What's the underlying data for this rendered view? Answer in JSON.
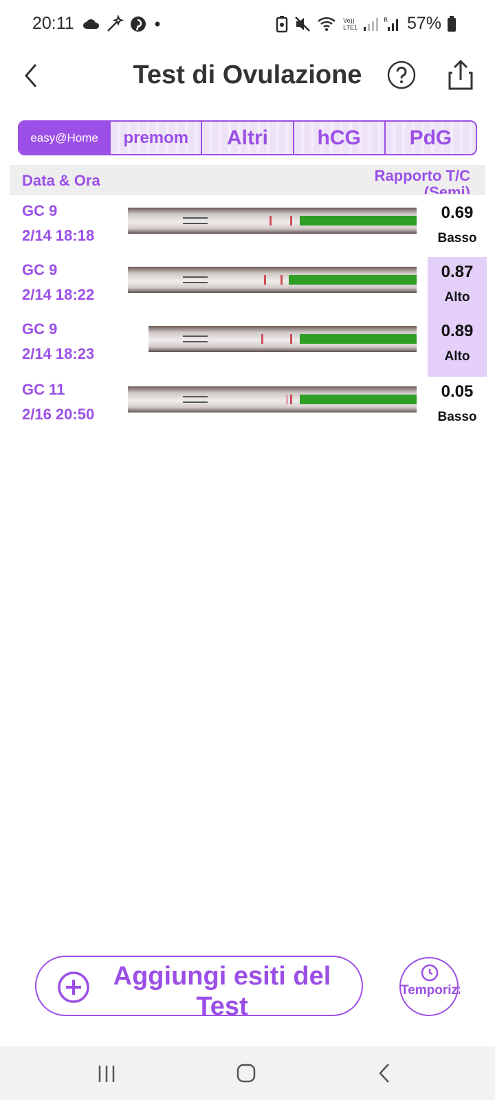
{
  "status_bar": {
    "time": "20:11",
    "battery_text": "57%",
    "left_icons": [
      "cloud-icon",
      "magic-wand-icon",
      "pinterest-icon",
      "dot-icon"
    ],
    "right_icons": [
      "battery-saver-icon",
      "mute-icon",
      "wifi-icon",
      "volte-icon",
      "signal-icon",
      "roaming-signal-icon",
      "battery-icon"
    ],
    "network_label": "LTE1",
    "volte_label": "Vo))"
  },
  "header": {
    "title": "Test di Ovulazione",
    "back_icon": "chevron-left-icon",
    "help_icon": "question-circle-icon",
    "share_icon": "share-icon"
  },
  "tabs": [
    {
      "label": "easy@Home",
      "active": true
    },
    {
      "label": "premom",
      "active": false
    },
    {
      "label": "Altri",
      "active": false
    },
    {
      "label": "hCG",
      "active": false
    },
    {
      "label": "PdG",
      "active": false
    }
  ],
  "table": {
    "col_date": "Data & Ora",
    "col_ratio": "Rapporto T/C (Semi)",
    "rows": [
      {
        "cycle_day": "GC 9",
        "date": "2/14  18:18",
        "value": "0.69",
        "level": "Basso",
        "high": false
      },
      {
        "cycle_day": "GC 9",
        "date": "2/14  18:22",
        "value": "0.87",
        "level": "Alto",
        "high": true
      },
      {
        "cycle_day": "GC 9",
        "date": "2/14  18:23",
        "value": "0.89",
        "level": "Alto",
        "high": true
      },
      {
        "cycle_day": "GC 11",
        "date": "2/16  20:50",
        "value": "0.05",
        "level": "Basso",
        "high": false
      }
    ]
  },
  "actions": {
    "add_results_label": "Aggiungi esiti del Test",
    "add_icon": "plus-circle-icon",
    "timer_label": "Temporizzatore",
    "timer_icon": "clock-icon"
  },
  "colors": {
    "accent": "#9b4fe6",
    "high_bg": "#e3cff8",
    "strip_green": "#2f9e25",
    "strip_line": "#d24c5a"
  },
  "nav_bar": {
    "icons": [
      "recent-apps-icon",
      "home-icon",
      "back-icon"
    ]
  }
}
